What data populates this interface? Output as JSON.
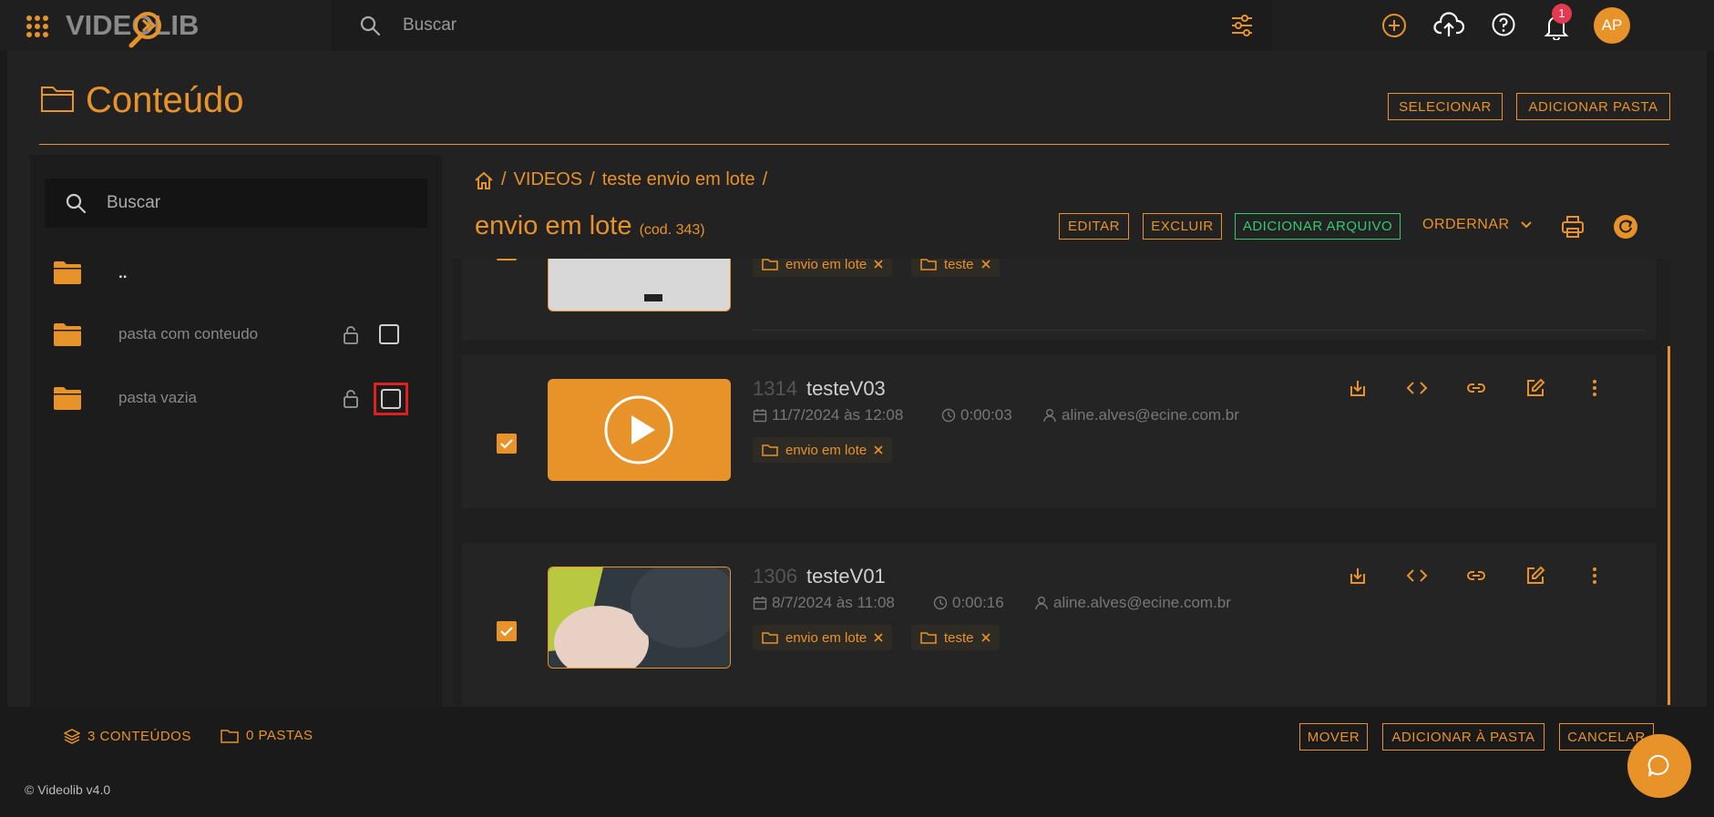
{
  "app": {
    "logo": "VIDEOLIB",
    "search_placeholder": "Buscar",
    "notification_count": "1",
    "avatar_initials": "AP"
  },
  "header": {
    "title": "Conteúdo",
    "select_label": "SELECIONAR",
    "add_folder_label": "ADICIONAR PASTA"
  },
  "sidebar": {
    "search_placeholder": "Buscar",
    "items": [
      {
        "label": ".."
      },
      {
        "label": "pasta com conteudo"
      },
      {
        "label": "pasta vazia"
      }
    ]
  },
  "content": {
    "breadcrumb": {
      "sep": "/",
      "videos": "VIDEOS",
      "parent": "teste envio em lote"
    },
    "folder_name": "envio em lote",
    "folder_code": "(cod. 343)",
    "actions": {
      "edit": "EDITAR",
      "delete": "EXCLUIR",
      "add_file": "ADICIONAR ARQUIVO",
      "sort": "ORDERNAR"
    },
    "videos": [
      {
        "tags": [
          "envio em lote",
          "teste"
        ]
      },
      {
        "code": "1314",
        "name": "testeV03",
        "date": "11/7/2024 às 12:08",
        "duration": "0:00:03",
        "owner": "aline.alves@ecine.com.br",
        "tags": [
          "envio em lote"
        ],
        "checked": true
      },
      {
        "code": "1306",
        "name": "testeV01",
        "date": "8/7/2024 às 11:08",
        "duration": "0:00:16",
        "owner": "aline.alves@ecine.com.br",
        "tags": [
          "envio em lote",
          "teste"
        ],
        "checked": true
      }
    ]
  },
  "bottom": {
    "contents_count": "3 CONTEÚDOS",
    "folders_count": "0 PASTAS",
    "move": "MOVER",
    "add_to_folder": "ADICIONAR À PASTA",
    "cancel": "CANCELAR",
    "footer": "© Videolib v4.0"
  },
  "colors": {
    "accent": "#e8922a",
    "highlight": "#e02020",
    "success": "#2ecc71",
    "badge": "#e53950"
  }
}
